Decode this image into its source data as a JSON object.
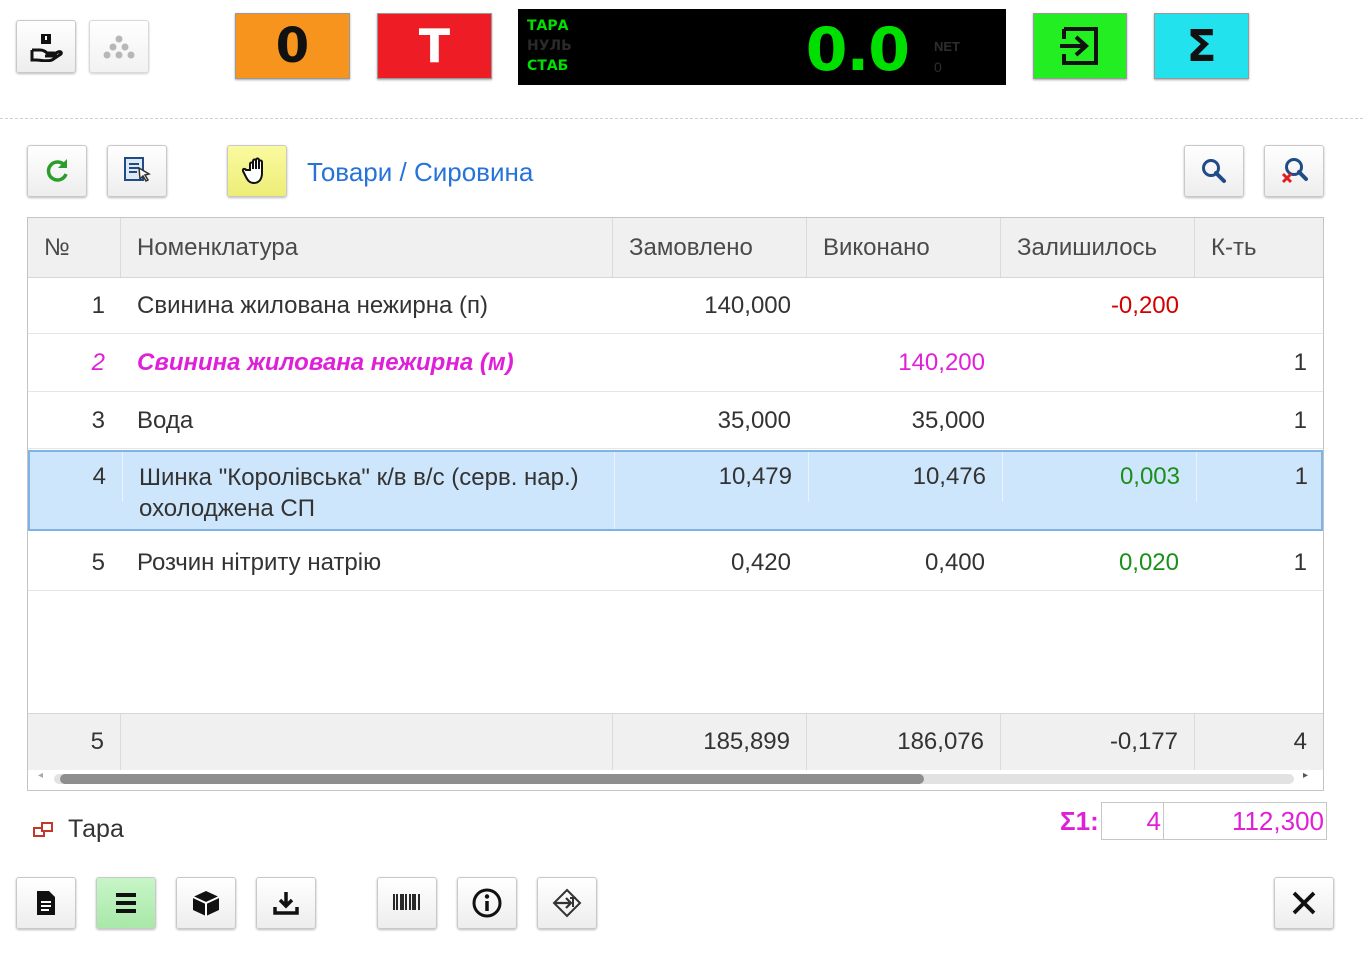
{
  "topbar": {
    "zero_btn": "0",
    "tare_btn": "T",
    "scale": {
      "labels": [
        "ТАРА",
        "НУЛЬ",
        "СТАБ"
      ],
      "value": "0.0",
      "net_label": "NET",
      "net_value": "0"
    },
    "sum_btn": "Σ"
  },
  "colors": {
    "orange": "#f7941d",
    "red": "#ee1c25",
    "green": "#22ee22",
    "cyan": "#22e2ee",
    "display_green": "#00e000",
    "link_blue": "#2673d9",
    "magenta": "#e020d8",
    "negative_red": "#d40000",
    "positive_green": "#1a8f1a",
    "selected_row": "#cde6fb"
  },
  "toolbar": {
    "breadcrumb": "Товари / Сировина"
  },
  "table": {
    "headers": [
      "№",
      "Номенклатура",
      "Замовлено",
      "Виконано",
      "Залишилось",
      "К-ть"
    ],
    "rows": [
      {
        "num": "1",
        "name": "Свинина жилована нежирна (п)",
        "ordered": "140,000",
        "done": "",
        "left": "-0,200",
        "qty": ""
      },
      {
        "num": "2",
        "name": "Свинина жилована нежирна (м)",
        "ordered": "",
        "done": "140,200",
        "left": "",
        "qty": "1"
      },
      {
        "num": "3",
        "name": "Вода",
        "ordered": "35,000",
        "done": "35,000",
        "left": "",
        "qty": "1"
      },
      {
        "num": "4",
        "name": "Шинка \"Королівська\" к/в в/с (серв. нар.) охолоджена СП",
        "ordered": "10,479",
        "done": "10,476",
        "left": "0,003",
        "qty": "1"
      },
      {
        "num": "5",
        "name": "Розчин нітриту натрію",
        "ordered": "0,420",
        "done": "0,400",
        "left": "0,020",
        "qty": "1"
      }
    ],
    "footer": {
      "num": "5",
      "ordered": "185,899",
      "done": "186,076",
      "left": "-0,177",
      "qty": "4"
    }
  },
  "tara": {
    "label": "Тара"
  },
  "summary": {
    "label": "Σ1:",
    "count": "4",
    "total": "112,300"
  }
}
